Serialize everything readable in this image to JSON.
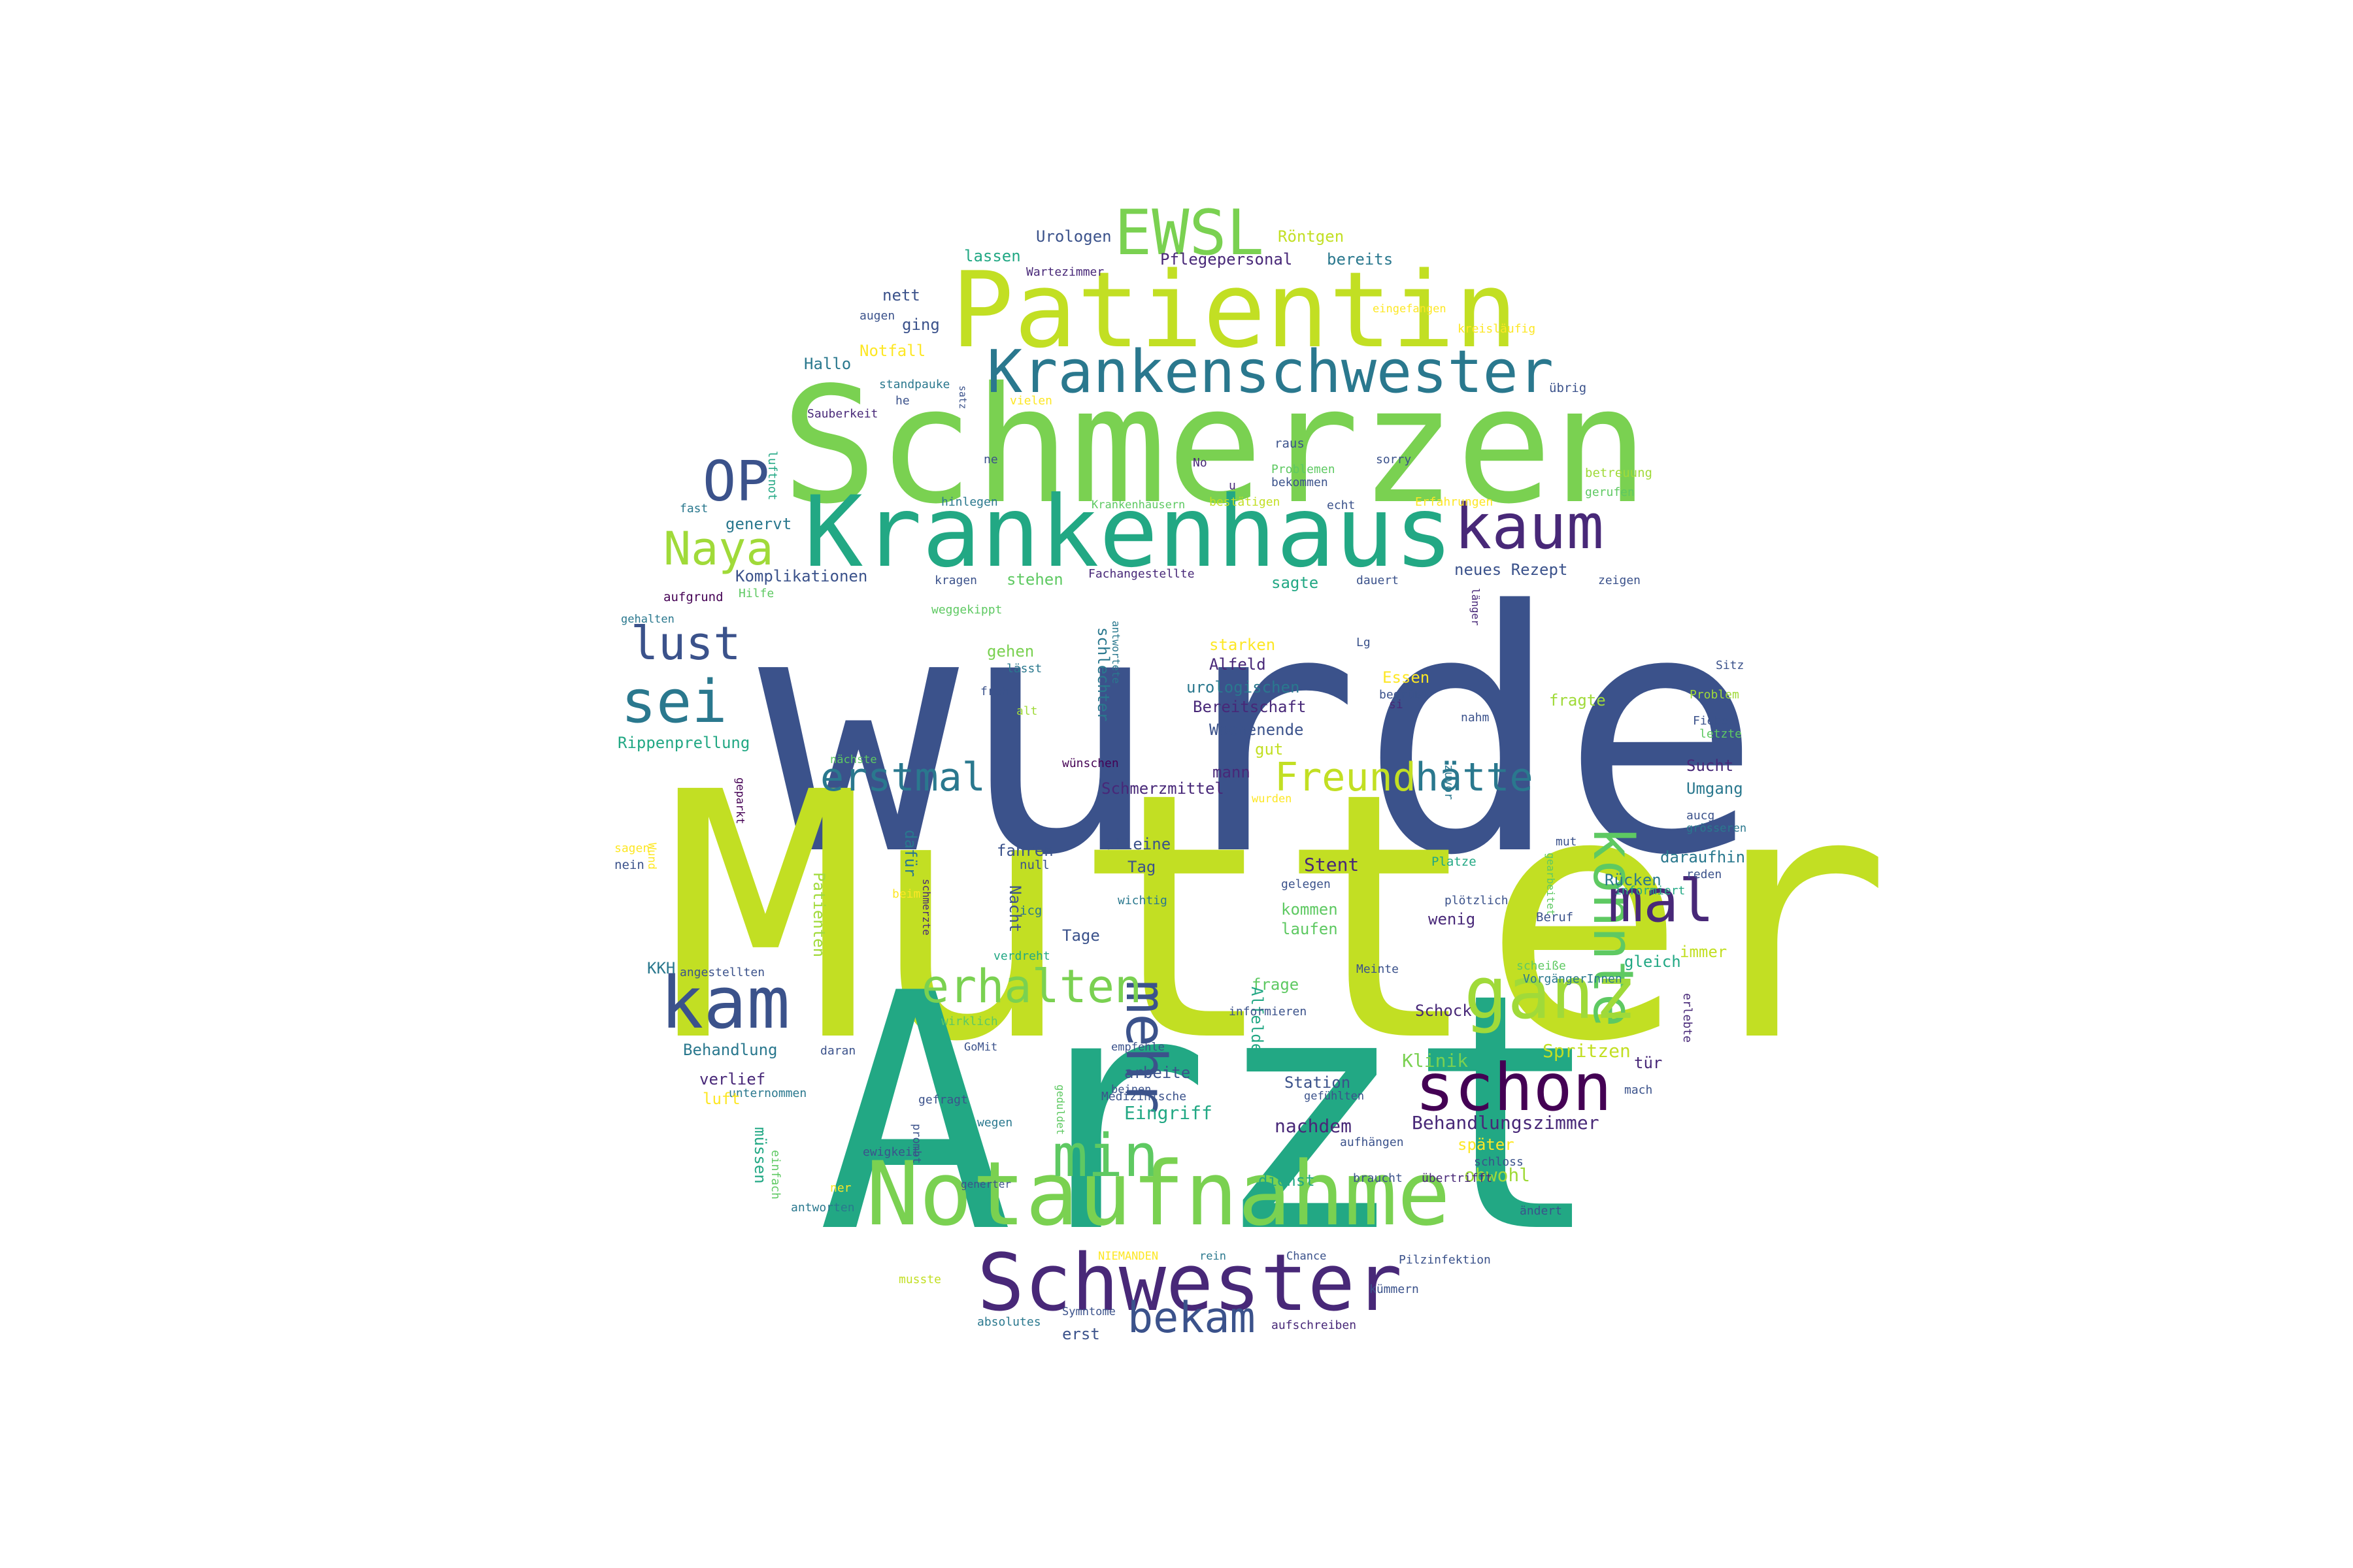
{
  "words": [
    {
      "t": "wurde",
      "c": "#3b528b"
    },
    {
      "t": "Mutter",
      "c": "#c2df23"
    },
    {
      "t": "Arzt",
      "c": "#22a884"
    },
    {
      "t": "Schmerzen",
      "c": "#7ad151"
    },
    {
      "t": "Krankenhaus",
      "c": "#22a884"
    },
    {
      "t": "Patientin",
      "c": "#c2df23"
    },
    {
      "t": "Notaufnahme",
      "c": "#7ad151"
    },
    {
      "t": "Schwester",
      "c": "#482878"
    },
    {
      "t": "Krankenschwester",
      "c": "#2a788e"
    },
    {
      "t": "EWSL",
      "c": "#7ad151"
    },
    {
      "t": "kaum",
      "c": "#482878"
    },
    {
      "t": "OP",
      "c": "#3b528b"
    },
    {
      "t": "Naya",
      "c": "#a0da39"
    },
    {
      "t": "sei",
      "c": "#2a788e"
    },
    {
      "t": "lust",
      "c": "#3b528b"
    },
    {
      "t": "erstmal",
      "c": "#2a788e"
    },
    {
      "t": "Freund",
      "c": "#c2df23"
    },
    {
      "t": "hätte",
      "c": "#2a788e"
    },
    {
      "t": "konnte",
      "c": "#5ec962"
    },
    {
      "t": "mehr",
      "c": "#3b528b"
    },
    {
      "t": "mal",
      "c": "#482878"
    },
    {
      "t": "kam",
      "c": "#3b528b"
    },
    {
      "t": "erhalten",
      "c": "#7ad151"
    },
    {
      "t": "ganz",
      "c": "#a0da39"
    },
    {
      "t": "schon",
      "c": "#440154"
    },
    {
      "t": "min",
      "c": "#5ec962"
    },
    {
      "t": "bekam",
      "c": "#3b528b"
    },
    {
      "t": "Urologen",
      "c": "#3b528b"
    },
    {
      "t": "Röntgen",
      "c": "#c2df23"
    },
    {
      "t": "lassen",
      "c": "#22a884"
    },
    {
      "t": "Pflegepersonal",
      "c": "#482878"
    },
    {
      "t": "bereits",
      "c": "#2a788e"
    },
    {
      "t": "Wartezimmer",
      "c": "#482878"
    },
    {
      "t": "eingefangen",
      "c": "#fde725"
    },
    {
      "t": "nett",
      "c": "#3b528b"
    },
    {
      "t": "augen",
      "c": "#3b528b"
    },
    {
      "t": "ging",
      "c": "#3b528b"
    },
    {
      "t": "Notfall",
      "c": "#fde725"
    },
    {
      "t": "Hallo",
      "c": "#2a788e"
    },
    {
      "t": "standpauke",
      "c": "#2a788e"
    },
    {
      "t": "he",
      "c": "#3b528b"
    },
    {
      "t": "vielen",
      "c": "#fde725"
    },
    {
      "t": "satz",
      "c": "#3b528b"
    },
    {
      "t": "kreisläufig",
      "c": "#fde725"
    },
    {
      "t": "übrig",
      "c": "#3b528b"
    },
    {
      "t": "luftnot",
      "c": "#22a884"
    },
    {
      "t": "Sauberkeit",
      "c": "#482878"
    },
    {
      "t": "raus",
      "c": "#3b528b"
    },
    {
      "t": "No",
      "c": "#482878"
    },
    {
      "t": "ne",
      "c": "#3b528b"
    },
    {
      "t": "sorry",
      "c": "#3b528b"
    },
    {
      "t": "Problemen",
      "c": "#5ec962"
    },
    {
      "t": "u",
      "c": "#482878"
    },
    {
      "t": "bekommen",
      "c": "#3b528b"
    },
    {
      "t": "betreuung",
      "c": "#a0da39"
    },
    {
      "t": "gerufen",
      "c": "#5ec962"
    },
    {
      "t": "fast",
      "c": "#2a788e"
    },
    {
      "t": "hinlegen",
      "c": "#2a788e"
    },
    {
      "t": "Krankenhäusern",
      "c": "#5ec962"
    },
    {
      "t": "bestätigen",
      "c": "#c2df23"
    },
    {
      "t": "echt",
      "c": "#3b528b"
    },
    {
      "t": "Erfahrungen",
      "c": "#fde725"
    },
    {
      "t": "genervt",
      "c": "#2a788e"
    },
    {
      "t": "Komplikationen",
      "c": "#3b528b"
    },
    {
      "t": "kragen",
      "c": "#3b528b"
    },
    {
      "t": "stehen",
      "c": "#5ec962"
    },
    {
      "t": "Fachangestellte",
      "c": "#482878"
    },
    {
      "t": "sagte",
      "c": "#22a884"
    },
    {
      "t": "dauert",
      "c": "#3b528b"
    },
    {
      "t": "neues Rezept",
      "c": "#3b528b"
    },
    {
      "t": "zeigen",
      "c": "#3b528b"
    },
    {
      "t": "länger",
      "c": "#482878"
    },
    {
      "t": "aufgrund",
      "c": "#440154"
    },
    {
      "t": "Hilfe",
      "c": "#5ec962"
    },
    {
      "t": "weggekippt",
      "c": "#5ec962"
    },
    {
      "t": "gehalten",
      "c": "#2a788e"
    },
    {
      "t": "antwortete",
      "c": "#2a788e"
    },
    {
      "t": "starken",
      "c": "#fde725"
    },
    {
      "t": "Lg",
      "c": "#3b528b"
    },
    {
      "t": "gehen",
      "c": "#7ad151"
    },
    {
      "t": "lässt",
      "c": "#2a788e"
    },
    {
      "t": "froh",
      "c": "#3b528b"
    },
    {
      "t": "alt",
      "c": "#a0da39"
    },
    {
      "t": "schlechter",
      "c": "#2a788e"
    },
    {
      "t": "Alfeld",
      "c": "#482878"
    },
    {
      "t": "urologischen",
      "c": "#2a788e"
    },
    {
      "t": "Essen",
      "c": "#fde725"
    },
    {
      "t": "begrüßt",
      "c": "#3b528b"
    },
    {
      "t": "si",
      "c": "#482878"
    },
    {
      "t": "fragte",
      "c": "#a0da39"
    },
    {
      "t": "Sitz",
      "c": "#3b528b"
    },
    {
      "t": "Problem",
      "c": "#a0da39"
    },
    {
      "t": "Bereitschaft",
      "c": "#482878"
    },
    {
      "t": "Wochenende",
      "c": "#3b528b"
    },
    {
      "t": "nahm",
      "c": "#3b528b"
    },
    {
      "t": "Fieber",
      "c": "#3b528b"
    },
    {
      "t": "letzte",
      "c": "#5ec962"
    },
    {
      "t": "Rippenprellung",
      "c": "#22a884"
    },
    {
      "t": "gut",
      "c": "#c2df23"
    },
    {
      "t": "nächste",
      "c": "#5ec962"
    },
    {
      "t": "wünschen",
      "c": "#440154"
    },
    {
      "t": "mann",
      "c": "#482878"
    },
    {
      "t": "Sucht",
      "c": "#482878"
    },
    {
      "t": "zuvor",
      "c": "#2a788e"
    },
    {
      "t": "Umgang",
      "c": "#2a788e"
    },
    {
      "t": "geparkt",
      "c": "#440154"
    },
    {
      "t": "Schmerzmittel",
      "c": "#482878"
    },
    {
      "t": "wurden",
      "c": "#fde725"
    },
    {
      "t": "aucg",
      "c": "#3b528b"
    },
    {
      "t": "grösseren",
      "c": "#2a788e"
    },
    {
      "t": "alleine",
      "c": "#3b528b"
    },
    {
      "t": "fahren",
      "c": "#3b528b"
    },
    {
      "t": "dafür",
      "c": "#2a788e"
    },
    {
      "t": "sagen",
      "c": "#fde725"
    },
    {
      "t": "nein",
      "c": "#3b528b"
    },
    {
      "t": "Wund",
      "c": "#fde725"
    },
    {
      "t": "mut",
      "c": "#3b528b"
    },
    {
      "t": "gearbeitet",
      "c": "#5ec962"
    },
    {
      "t": "daraufhin",
      "c": "#2a788e"
    },
    {
      "t": "Tag",
      "c": "#3b528b"
    },
    {
      "t": "Stent",
      "c": "#482878"
    },
    {
      "t": "null",
      "c": "#3b528b"
    },
    {
      "t": "Platze",
      "c": "#22a884"
    },
    {
      "t": "Rücken",
      "c": "#2a788e"
    },
    {
      "t": "informiert",
      "c": "#22a884"
    },
    {
      "t": "reden",
      "c": "#3b528b"
    },
    {
      "t": "Patienten",
      "c": "#a0da39"
    },
    {
      "t": "beim",
      "c": "#fde725"
    },
    {
      "t": "schmerzte",
      "c": "#482878"
    },
    {
      "t": "Nacht",
      "c": "#3b528b"
    },
    {
      "t": "wichtig",
      "c": "#2a788e"
    },
    {
      "t": "gelegen",
      "c": "#3b528b"
    },
    {
      "t": "plötzlich",
      "c": "#3b528b"
    },
    {
      "t": "kommen",
      "c": "#5ec962"
    },
    {
      "t": "icg",
      "c": "#2a788e"
    },
    {
      "t": "wenig",
      "c": "#482878"
    },
    {
      "t": "Beruf",
      "c": "#3b528b"
    },
    {
      "t": "immer",
      "c": "#c2df23"
    },
    {
      "t": "gleich",
      "c": "#22a884"
    },
    {
      "t": "Tage",
      "c": "#3b528b"
    },
    {
      "t": "laufen",
      "c": "#5ec962"
    },
    {
      "t": "verdreht",
      "c": "#22a884"
    },
    {
      "t": "KKH",
      "c": "#2a788e"
    },
    {
      "t": "angestellten",
      "c": "#3b528b"
    },
    {
      "t": "Meinte",
      "c": "#3b528b"
    },
    {
      "t": "scheiße",
      "c": "#5ec962"
    },
    {
      "t": "VorgängerInnen",
      "c": "#2a788e"
    },
    {
      "t": "frage",
      "c": "#5ec962"
    },
    {
      "t": "Alfelder",
      "c": "#22a884"
    },
    {
      "t": "Schock",
      "c": "#482878"
    },
    {
      "t": "informieren",
      "c": "#3b528b"
    },
    {
      "t": "wirklich",
      "c": "#5ec962"
    },
    {
      "t": "erlebte",
      "c": "#482878"
    },
    {
      "t": "Behandlung",
      "c": "#2a788e"
    },
    {
      "t": "daran",
      "c": "#3b528b"
    },
    {
      "t": "GoMit",
      "c": "#3b528b"
    },
    {
      "t": "empfehle",
      "c": "#3b528b"
    },
    {
      "t": "Klinik",
      "c": "#7ad151"
    },
    {
      "t": "Spritzen",
      "c": "#c2df23"
    },
    {
      "t": "verlief",
      "c": "#482878"
    },
    {
      "t": "arbeite",
      "c": "#3b528b"
    },
    {
      "t": "tür",
      "c": "#482878"
    },
    {
      "t": "unternommen",
      "c": "#2a788e"
    },
    {
      "t": "beinen",
      "c": "#3b528b"
    },
    {
      "t": "Eingriff",
      "c": "#22a884"
    },
    {
      "t": "Station",
      "c": "#3b528b"
    },
    {
      "t": "luft",
      "c": "#fde725"
    },
    {
      "t": "Medizinische",
      "c": "#3b528b"
    },
    {
      "t": "gefühlten",
      "c": "#3b528b"
    },
    {
      "t": "mach",
      "c": "#3b528b"
    },
    {
      "t": "gefragt",
      "c": "#3b528b"
    },
    {
      "t": "wegen",
      "c": "#2a788e"
    },
    {
      "t": "geduldet",
      "c": "#5ec962"
    },
    {
      "t": "nachdem",
      "c": "#482878"
    },
    {
      "t": "Behandlungszimmer",
      "c": "#482878"
    },
    {
      "t": "müssen",
      "c": "#22a884"
    },
    {
      "t": "einfach",
      "c": "#5ec962"
    },
    {
      "t": "prombt",
      "c": "#3b528b"
    },
    {
      "t": "aufhängen",
      "c": "#3b528b"
    },
    {
      "t": "später",
      "c": "#fde725"
    },
    {
      "t": "ewigkeit",
      "c": "#3b528b"
    },
    {
      "t": "schloss",
      "c": "#3b528b"
    },
    {
      "t": "obwohl",
      "c": "#a0da39"
    },
    {
      "t": "ner",
      "c": "#fde725"
    },
    {
      "t": "generter",
      "c": "#3b528b"
    },
    {
      "t": "dienst",
      "c": "#22a884"
    },
    {
      "t": "braucht",
      "c": "#3b528b"
    },
    {
      "t": "übertrifft",
      "c": "#482878"
    },
    {
      "t": "antworten",
      "c": "#2a788e"
    },
    {
      "t": "ändert",
      "c": "#3b528b"
    },
    {
      "t": "NIEMANDEN",
      "c": "#fde725"
    },
    {
      "t": "rein",
      "c": "#2a788e"
    },
    {
      "t": "Chance",
      "c": "#3b528b"
    },
    {
      "t": "Pilzinfektion",
      "c": "#3b528b"
    },
    {
      "t": "musste",
      "c": "#c2df23"
    },
    {
      "t": "kümmern",
      "c": "#3b528b"
    },
    {
      "t": "Symntome",
      "c": "#3b528b"
    },
    {
      "t": "absolutes",
      "c": "#2a788e"
    },
    {
      "t": "aufschreiben",
      "c": "#482878"
    },
    {
      "t": "erst",
      "c": "#3b528b"
    }
  ]
}
